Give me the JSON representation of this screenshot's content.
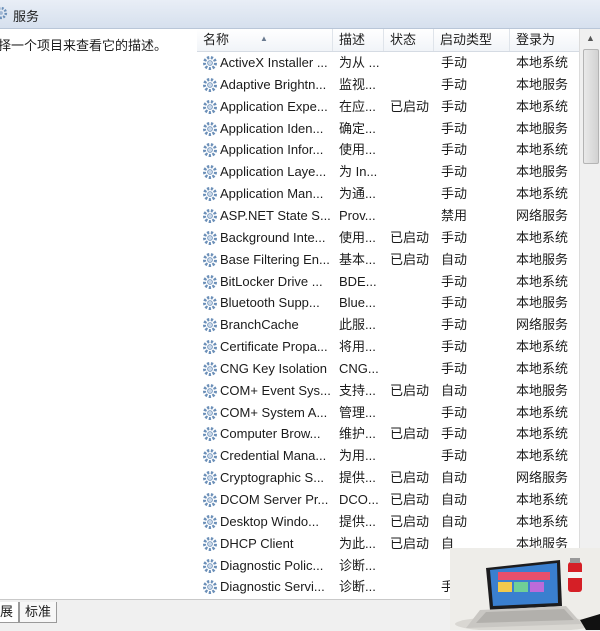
{
  "window": {
    "title": "服务"
  },
  "description_pane": {
    "text": "择一个项目来查看它的描述。"
  },
  "columns": [
    "名称",
    "描述",
    "状态",
    "启动类型",
    "登录为"
  ],
  "services": [
    {
      "name": "ActiveX Installer ...",
      "desc": "为从 ...",
      "status": "",
      "startup": "手动",
      "logon": "本地系统"
    },
    {
      "name": "Adaptive Brightn...",
      "desc": "监视...",
      "status": "",
      "startup": "手动",
      "logon": "本地服务"
    },
    {
      "name": "Application Expe...",
      "desc": "在应...",
      "status": "已启动",
      "startup": "手动",
      "logon": "本地系统"
    },
    {
      "name": "Application Iden...",
      "desc": "确定...",
      "status": "",
      "startup": "手动",
      "logon": "本地服务"
    },
    {
      "name": "Application Infor...",
      "desc": "使用...",
      "status": "",
      "startup": "手动",
      "logon": "本地系统"
    },
    {
      "name": "Application Laye...",
      "desc": "为 In...",
      "status": "",
      "startup": "手动",
      "logon": "本地服务"
    },
    {
      "name": "Application Man...",
      "desc": "为通...",
      "status": "",
      "startup": "手动",
      "logon": "本地系统"
    },
    {
      "name": "ASP.NET State S...",
      "desc": "Prov...",
      "status": "",
      "startup": "禁用",
      "logon": "网络服务"
    },
    {
      "name": "Background Inte...",
      "desc": "使用...",
      "status": "已启动",
      "startup": "手动",
      "logon": "本地系统"
    },
    {
      "name": "Base Filtering En...",
      "desc": "基本...",
      "status": "已启动",
      "startup": "自动",
      "logon": "本地服务"
    },
    {
      "name": "BitLocker Drive ...",
      "desc": "BDE...",
      "status": "",
      "startup": "手动",
      "logon": "本地系统"
    },
    {
      "name": "Bluetooth Supp...",
      "desc": "Blue...",
      "status": "",
      "startup": "手动",
      "logon": "本地服务"
    },
    {
      "name": "BranchCache",
      "desc": "此服...",
      "status": "",
      "startup": "手动",
      "logon": "网络服务"
    },
    {
      "name": "Certificate Propa...",
      "desc": "将用...",
      "status": "",
      "startup": "手动",
      "logon": "本地系统"
    },
    {
      "name": "CNG Key Isolation",
      "desc": "CNG...",
      "status": "",
      "startup": "手动",
      "logon": "本地系统"
    },
    {
      "name": "COM+ Event Sys...",
      "desc": "支持...",
      "status": "已启动",
      "startup": "自动",
      "logon": "本地服务"
    },
    {
      "name": "COM+ System A...",
      "desc": "管理...",
      "status": "",
      "startup": "手动",
      "logon": "本地系统"
    },
    {
      "name": "Computer Brow...",
      "desc": "维护...",
      "status": "已启动",
      "startup": "手动",
      "logon": "本地系统"
    },
    {
      "name": "Credential Mana...",
      "desc": "为用...",
      "status": "",
      "startup": "手动",
      "logon": "本地系统"
    },
    {
      "name": "Cryptographic S...",
      "desc": "提供...",
      "status": "已启动",
      "startup": "自动",
      "logon": "网络服务"
    },
    {
      "name": "DCOM Server Pr...",
      "desc": "DCO...",
      "status": "已启动",
      "startup": "自动",
      "logon": "本地系统"
    },
    {
      "name": "Desktop Windo...",
      "desc": "提供...",
      "status": "已启动",
      "startup": "自动",
      "logon": "本地系统"
    },
    {
      "name": "DHCP Client",
      "desc": "为此...",
      "status": "已启动",
      "startup": "自",
      "logon": "本地服务"
    },
    {
      "name": "Diagnostic Polic...",
      "desc": "诊断...",
      "status": "",
      "startup": "",
      "logon": ""
    },
    {
      "name": "Diagnostic Servi...",
      "desc": "诊断...",
      "status": "",
      "startup": "手",
      "logon": ""
    }
  ],
  "tabs": [
    "展",
    "标准"
  ],
  "icons": {
    "service": "gear-icon",
    "window": "gear-icon",
    "sort": "sort-ascending-icon",
    "scroll_up": "scroll-up-arrow-icon"
  },
  "colors": {
    "title_strip": "#dfe7f2",
    "header_bg": "#f4f6f9",
    "scroll_track": "#f0f0f0",
    "gear_blue": "#6b8fb8"
  }
}
